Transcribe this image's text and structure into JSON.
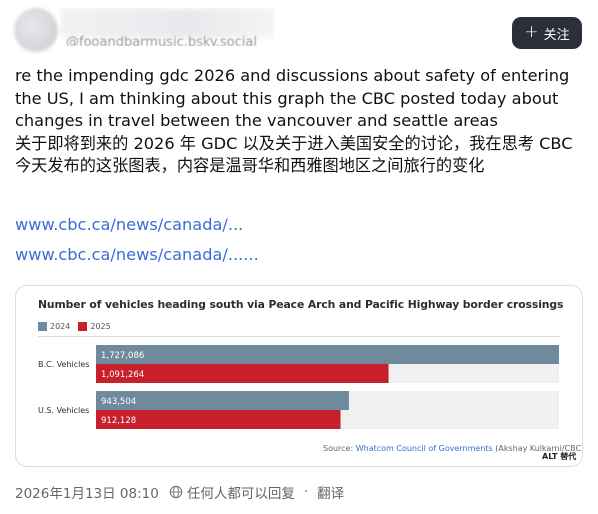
{
  "header": {
    "handle": "@fooandbarmusic.bsky.social",
    "follow_label": "关注"
  },
  "post": {
    "text_en": "re the impending gdc 2026 and discussions about safety of entering the US, I am thinking about this graph the CBC posted today about changes in travel between the vancouver and seattle areas",
    "text_zh": "关于即将到来的 2026 年 GDC 以及关于进入美国安全的讨论，我在思考 CBC 今天发布的这张图表，内容是温哥华和西雅图地区之间旅行的变化",
    "links": [
      "www.cbc.ca/news/canada/...",
      "www.cbc.ca/news/canada/......"
    ]
  },
  "card": {
    "alt_badge": "ALT 替代",
    "source_prefix": "Source: ",
    "source_org": "Whatcom Council of Governments",
    "source_credit": " (Akshay Kulkarni/CBC)"
  },
  "chart_data": {
    "type": "bar",
    "orientation": "horizontal",
    "title": "Number of vehicles heading south via Peace Arch and Pacific Highway border crossings",
    "categories": [
      "B.C. Vehicles",
      "U.S. Vehicles"
    ],
    "series": [
      {
        "name": "2024",
        "color": "#6f8a9c",
        "values": [
          1727086,
          943504
        ],
        "labels": [
          "1,727,086",
          "943,504"
        ]
      },
      {
        "name": "2025",
        "color": "#c8202a",
        "values": [
          1091264,
          912128
        ],
        "labels": [
          "1,091,264",
          "912,128"
        ]
      }
    ],
    "xlim": [
      0,
      1727086
    ],
    "track_color": "#f0f0f1",
    "grid": false,
    "legend_position": "top-left"
  },
  "footer": {
    "timestamp": "2026年1月13日 08:10",
    "visibility": "任何人都可以回复",
    "translate_label": "翻译"
  }
}
